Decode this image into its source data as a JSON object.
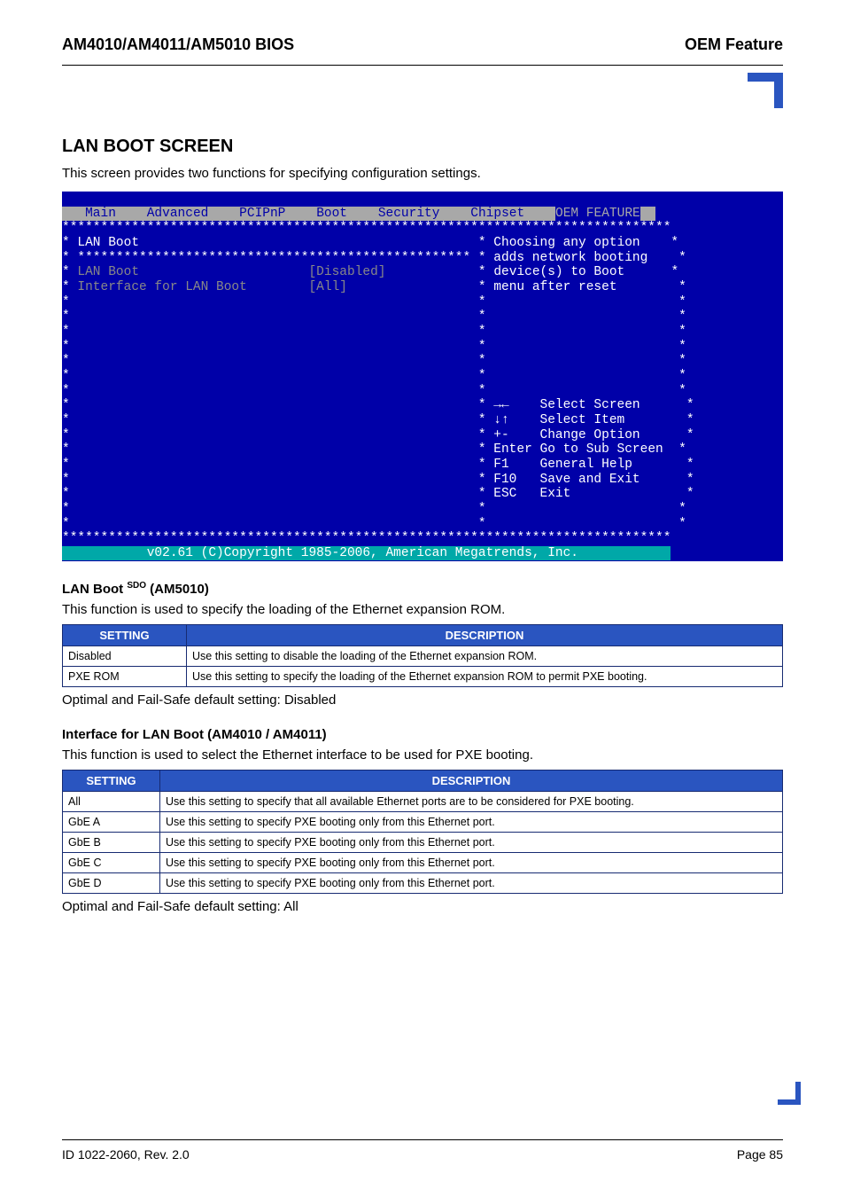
{
  "header": {
    "left": "AM4010/AM4011/AM5010 BIOS",
    "right": "OEM Feature"
  },
  "section": {
    "title": "LAN BOOT SCREEN",
    "intro": "This screen provides two functions for specifying configuration settings."
  },
  "bios": {
    "menu": [
      "Main",
      "Advanced",
      "PCIPnP",
      "Boot",
      "Security",
      "Chipset",
      "OEM FEATURE"
    ],
    "panel_title": "LAN Boot",
    "fields": [
      {
        "label": "LAN Boot",
        "value": "[Disabled]"
      },
      {
        "label": "Interface for LAN Boot",
        "value": "[All]"
      }
    ],
    "help": [
      "Choosing any option",
      "adds network booting",
      "device(s) to Boot",
      "menu after reset"
    ],
    "keys": [
      {
        "k": "→←",
        "d": "Select Screen"
      },
      {
        "k": "↓↑",
        "d": "Select Item"
      },
      {
        "k": "+-",
        "d": "Change Option"
      },
      {
        "k": "Enter",
        "d": "Go to Sub Screen"
      },
      {
        "k": "F1",
        "d": "General Help"
      },
      {
        "k": "F10",
        "d": "Save and Exit"
      },
      {
        "k": "ESC",
        "d": "Exit"
      }
    ],
    "copyright": "v02.61 (C)Copyright 1985-2006, American Megatrends, Inc."
  },
  "sub1": {
    "heading_prefix": "LAN Boot ",
    "heading_sdo": "SDO",
    "heading_suffix": " (AM5010)",
    "desc": "This function is used to specify the loading of the Ethernet expansion ROM.",
    "th1": "SETTING",
    "th2": "DESCRIPTION",
    "rows": [
      {
        "s": "Disabled",
        "d": "Use this setting to disable the loading of the Ethernet expansion ROM."
      },
      {
        "s": "PXE ROM",
        "d": "Use this setting to specify the loading of the Ethernet expansion ROM to permit PXE booting."
      }
    ],
    "default": "Optimal and Fail-Safe default setting: Disabled"
  },
  "sub2": {
    "heading": "Interface for LAN Boot (AM4010 / AM4011)",
    "desc": "This function is used to select the Ethernet interface to be used for PXE booting.",
    "th1": "SETTING",
    "th2": "DESCRIPTION",
    "rows": [
      {
        "s": "All",
        "d": "Use this setting to specify that all available Ethernet ports are to be considered for PXE booting."
      },
      {
        "s": "GbE A",
        "d": "Use this setting to specify PXE booting only from this Ethernet port."
      },
      {
        "s": "GbE B",
        "d": "Use this setting to specify PXE booting only from this Ethernet port."
      },
      {
        "s": "GbE C",
        "d": "Use this setting to specify PXE booting only from this Ethernet port."
      },
      {
        "s": "GbE D",
        "d": "Use this setting to specify PXE booting only from this Ethernet port."
      }
    ],
    "default": "Optimal and Fail-Safe default setting: All"
  },
  "footer": {
    "left": "ID 1022-2060, Rev. 2.0",
    "right": "Page 85"
  }
}
